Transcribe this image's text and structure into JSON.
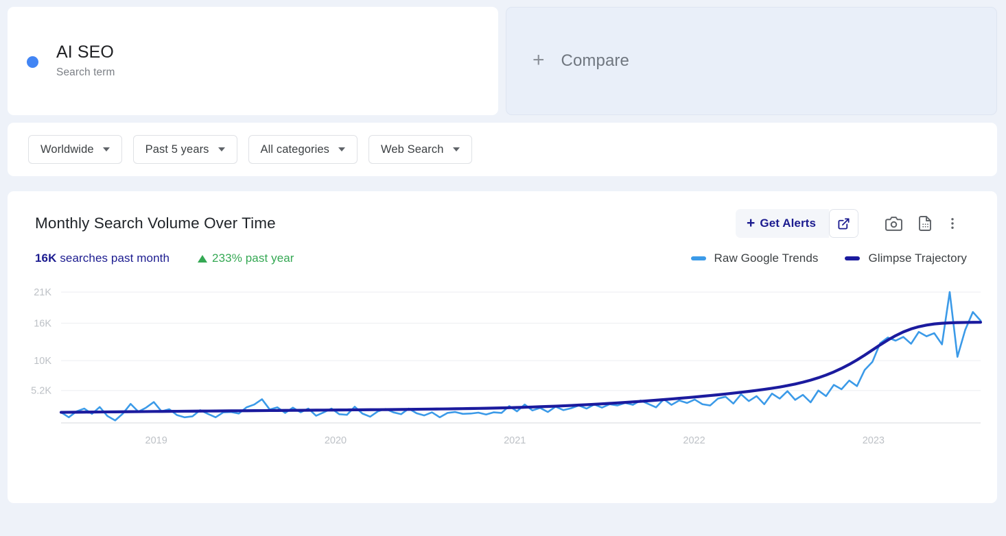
{
  "term_card": {
    "dot_color": "#4285f4",
    "title": "AI SEO",
    "subtitle": "Search term"
  },
  "compare_card": {
    "plus_icon": "plus-icon",
    "label": "Compare"
  },
  "filters": [
    {
      "label": "Worldwide",
      "icon": "chevron-down-icon"
    },
    {
      "label": "Past 5 years",
      "icon": "chevron-down-icon"
    },
    {
      "label": "All categories",
      "icon": "chevron-down-icon"
    },
    {
      "label": "Web Search",
      "icon": "chevron-down-icon"
    }
  ],
  "chart_card": {
    "title": "Monthly Search Volume Over Time",
    "toolbar": {
      "alerts_label": "Get Alerts",
      "alerts_plus": "+",
      "external_link_icon": "external-link-icon",
      "camera_icon": "camera-icon",
      "export_doc_icon": "document-export-icon",
      "kebab_icon": "more-vertical-icon"
    },
    "stats": {
      "volume_value": "16K",
      "volume_label": " searches past month",
      "growth_icon": "triangle-up-icon",
      "growth_text": "233% past year",
      "growth_color": "#34a853",
      "volume_color": "#1b1b8f"
    },
    "legend": [
      {
        "name": "Raw Google Trends",
        "color": "#3b9ae8"
      },
      {
        "name": "Glimpse Trajectory",
        "color": "#1b1b9e"
      }
    ]
  },
  "chart_data": {
    "type": "line",
    "title": "Monthly Search Volume Over Time",
    "xlabel": "",
    "ylabel": "",
    "grid": true,
    "legend_position": "top-right",
    "ylim": [
      0,
      22000
    ],
    "yticks": [
      5200,
      10000,
      16000,
      21000
    ],
    "ytick_labels": [
      "5.2K",
      "10K",
      "16K",
      "21K"
    ],
    "xticks": [
      "2019",
      "2020",
      "2021",
      "2022",
      "2023"
    ],
    "xlim": [
      "2018-07",
      "2023-08"
    ],
    "series": [
      {
        "name": "Raw Google Trends",
        "color": "#3b9ae8",
        "width": 2.6,
        "values": [
          1700,
          900,
          1850,
          2300,
          1450,
          2550,
          1100,
          400,
          1500,
          3050,
          1800,
          2450,
          3350,
          1850,
          2200,
          1250,
          900,
          1050,
          2050,
          1450,
          900,
          1700,
          1750,
          1500,
          2500,
          2950,
          3800,
          2150,
          2500,
          1600,
          2450,
          1700,
          2300,
          1150,
          1700,
          2300,
          1400,
          1300,
          2600,
          1500,
          1000,
          1850,
          2250,
          1700,
          1400,
          2300,
          1550,
          1200,
          1700,
          900,
          1600,
          1750,
          1450,
          1500,
          1650,
          1350,
          1700,
          1600,
          2700,
          1850,
          2950,
          2000,
          2400,
          1750,
          2600,
          2050,
          2350,
          2800,
          2300,
          2950,
          2450,
          3000,
          2800,
          3200,
          2900,
          3600,
          3050,
          2500,
          3800,
          2900,
          3600,
          3200,
          3750,
          3000,
          2800,
          3900,
          4200,
          3100,
          4600,
          3500,
          4300,
          3000,
          4700,
          3900,
          5100,
          3700,
          4500,
          3300,
          5200,
          4300,
          6100,
          5400,
          6800,
          5900,
          8500,
          9800,
          12800,
          13700,
          13200,
          13800,
          12700,
          14600,
          13900,
          14400,
          12600,
          21000,
          10600,
          14900,
          17800,
          16400
        ]
      },
      {
        "name": "Glimpse Trajectory",
        "color": "#1b1b9e",
        "width": 4.2,
        "values": [
          1700,
          1710,
          1720,
          1730,
          1745,
          1755,
          1765,
          1775,
          1790,
          1800,
          1810,
          1820,
          1835,
          1845,
          1855,
          1865,
          1875,
          1885,
          1895,
          1905,
          1915,
          1925,
          1935,
          1945,
          1955,
          1965,
          1975,
          1985,
          1995,
          2005,
          2015,
          2025,
          2035,
          2045,
          2055,
          2065,
          2075,
          2085,
          2095,
          2105,
          2115,
          2125,
          2135,
          2145,
          2160,
          2175,
          2190,
          2205,
          2220,
          2235,
          2250,
          2270,
          2290,
          2310,
          2330,
          2355,
          2380,
          2410,
          2440,
          2475,
          2510,
          2550,
          2595,
          2640,
          2690,
          2745,
          2800,
          2860,
          2925,
          2990,
          3060,
          3135,
          3210,
          3290,
          3375,
          3460,
          3550,
          3645,
          3740,
          3840,
          3945,
          4050,
          4160,
          4275,
          4390,
          4510,
          4640,
          4775,
          4915,
          5060,
          5215,
          5380,
          5560,
          5760,
          5985,
          6240,
          6530,
          6860,
          7240,
          7680,
          8180,
          8750,
          9390,
          10100,
          10880,
          11700,
          12520,
          13300,
          14000,
          14600,
          15080,
          15440,
          15700,
          15880,
          15990,
          16060,
          16100,
          16120,
          16140,
          16150
        ]
      }
    ]
  }
}
